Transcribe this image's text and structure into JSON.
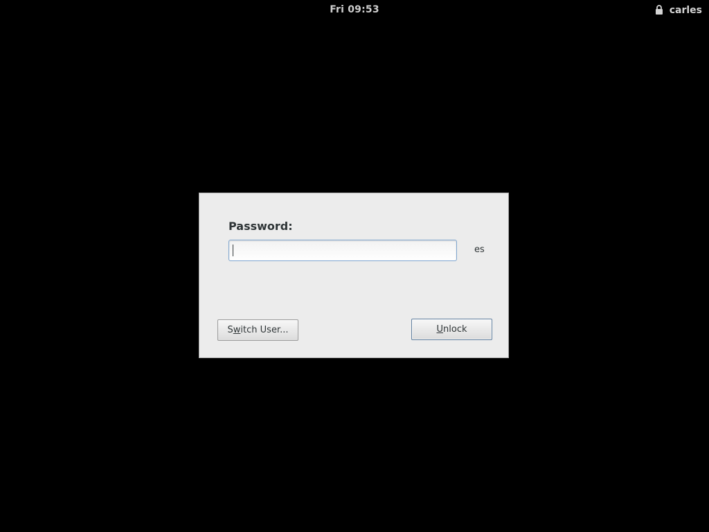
{
  "top_bar": {
    "clock": "Fri 09:53",
    "user_name": "carles",
    "icons": {
      "lock": "lock-icon"
    }
  },
  "dialog": {
    "password_label": "Password:",
    "password_value": "",
    "keyboard_layout": "es",
    "switch_user_button": {
      "pre": "S",
      "mnemonic": "w",
      "post": "itch User..."
    },
    "unlock_button": {
      "pre": "",
      "mnemonic": "U",
      "post": "nlock"
    }
  },
  "colors": {
    "background": "#000000",
    "dialog_background": "#ececec",
    "focus_border": "#7ea5cf",
    "top_bar_text": "#d4d4d4"
  }
}
